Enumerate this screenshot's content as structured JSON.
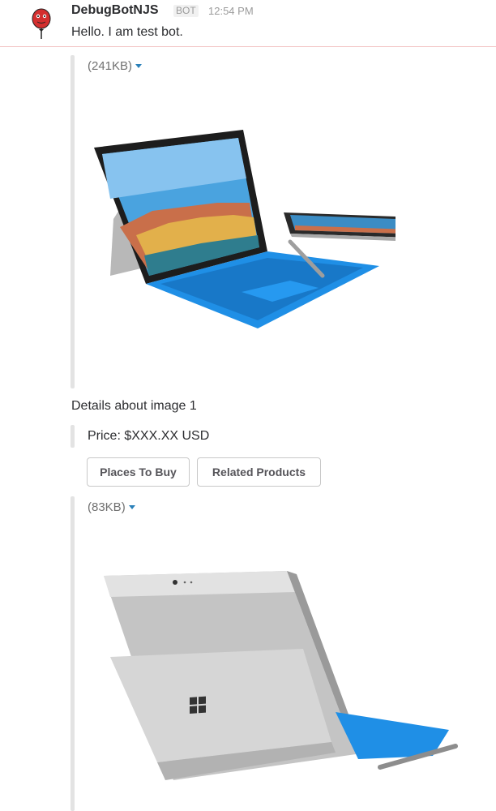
{
  "message": {
    "sender": "DebugBotNJS",
    "tag": "BOT",
    "time": "12:54 PM",
    "text": "Hello. I am test bot."
  },
  "attachments": [
    {
      "file_size": "(241KB)",
      "icon": "caret-down-icon"
    },
    {
      "file_size": "(83KB)",
      "icon": "caret-down-icon"
    }
  ],
  "details_title": "Details about image 1",
  "price_text": "Price: $XXX.XX USD",
  "actions": {
    "places_to_buy": "Places To Buy",
    "related_products": "Related Products"
  },
  "colors": {
    "accent": "#2a80b9",
    "keyboard_blue": "#1f8fe6",
    "bar_gray": "#e3e3e3"
  }
}
